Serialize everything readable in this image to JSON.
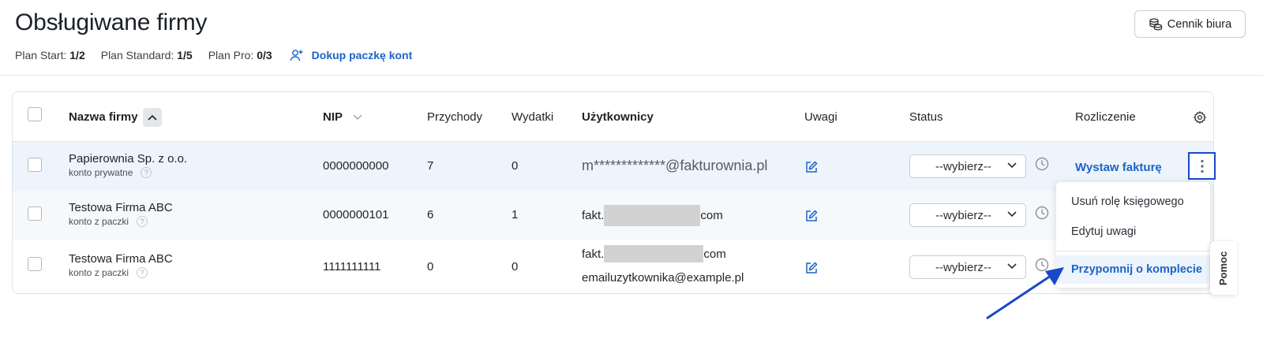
{
  "header": {
    "title": "Obsługiwane firmy",
    "price_button": "Cennik biura",
    "plans": [
      {
        "label": "Plan Start:",
        "value": "1/2"
      },
      {
        "label": "Plan Standard:",
        "value": "1/5"
      },
      {
        "label": "Plan Pro:",
        "value": "0/3"
      }
    ],
    "buy_link": "Dokup paczkę kont"
  },
  "table": {
    "columns": {
      "name": "Nazwa firmy",
      "nip": "NIP",
      "income": "Przychody",
      "expenses": "Wydatki",
      "users": "Użytkownicy",
      "notes": "Uwagi",
      "status": "Status",
      "billing": "Rozliczenie"
    },
    "rows": [
      {
        "name": "Papierownia Sp. z o.o.",
        "type": "konto prywatne",
        "nip": "0000000000",
        "income": "7",
        "expenses": "0",
        "user1": "m*************@fakturownia.pl",
        "status": "--wybierz--",
        "billing_link": "Wystaw fakturę"
      },
      {
        "name": "Testowa Firma ABC",
        "type": "konto z paczki",
        "nip": "0000000101",
        "income": "6",
        "expenses": "1",
        "user1_prefix": "fakt.",
        "user1_suffix": "com",
        "status": "--wybierz--"
      },
      {
        "name": "Testowa Firma ABC",
        "type": "konto z paczki",
        "nip": "1111111111",
        "income": "0",
        "expenses": "0",
        "user1_prefix": "fakt.",
        "user1_suffix": "com",
        "user2": "emailuzytkownika@example.pl",
        "status": "--wybierz--"
      }
    ]
  },
  "menu": {
    "items": [
      "Usuń rolę księgowego",
      "Edytuj uwagi",
      "Przypomnij o komplecie"
    ]
  },
  "help_tab": "Pomoc",
  "colors": {
    "accent": "#1a64c8",
    "highlight_border": "#1749c9",
    "row_selected": "#eef4fb"
  }
}
